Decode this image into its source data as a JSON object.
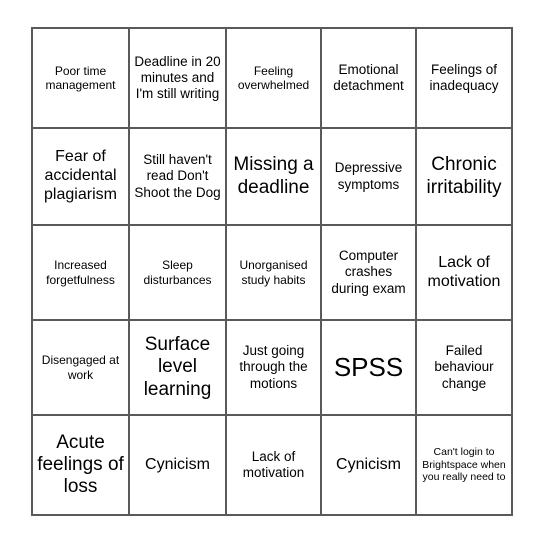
{
  "card": {
    "type": "bingo-card",
    "columns": 5,
    "rows": 5,
    "border_color": "#5a5a5a",
    "background_color": "#ffffff",
    "text_color": "#000000",
    "cells": [
      {
        "text": "Poor time management",
        "size": "s"
      },
      {
        "text": "Deadline in 20 minutes and I'm still writing",
        "size": "m"
      },
      {
        "text": "Feeling overwhelmed",
        "size": "s"
      },
      {
        "text": "Emotional detachment",
        "size": "m"
      },
      {
        "text": "Feelings of inadequacy",
        "size": "m"
      },
      {
        "text": "Fear of accidental plagiarism",
        "size": "l"
      },
      {
        "text": "Still haven't read Don't Shoot the Dog",
        "size": "m"
      },
      {
        "text": "Missing a deadline",
        "size": "xl"
      },
      {
        "text": "Depressive symptoms",
        "size": "m"
      },
      {
        "text": "Chronic irritability",
        "size": "xl"
      },
      {
        "text": "Increased forgetfulness",
        "size": "s"
      },
      {
        "text": "Sleep disturbances",
        "size": "s"
      },
      {
        "text": "Unorganised study habits",
        "size": "s"
      },
      {
        "text": "Computer crashes during exam",
        "size": "m"
      },
      {
        "text": "Lack of motivation",
        "size": "l"
      },
      {
        "text": "Disengaged at work",
        "size": "s"
      },
      {
        "text": "Surface level learning",
        "size": "xl"
      },
      {
        "text": "Just going through the motions",
        "size": "m"
      },
      {
        "text": "SPSS",
        "size": "xxl"
      },
      {
        "text": "Failed behaviour change",
        "size": "m"
      },
      {
        "text": "Acute feelings of loss",
        "size": "xl"
      },
      {
        "text": "Cynicism",
        "size": "l"
      },
      {
        "text": "Lack of motivation",
        "size": "m"
      },
      {
        "text": "Cynicism",
        "size": "l"
      },
      {
        "text": "Can't login to Brightspace when you really need to",
        "size": "xs"
      }
    ]
  }
}
